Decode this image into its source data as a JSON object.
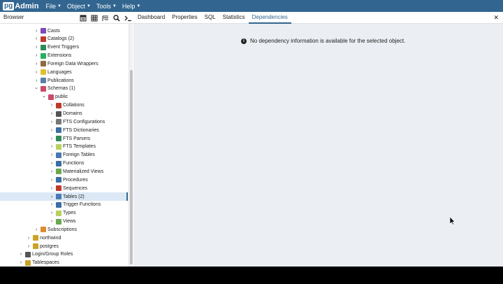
{
  "navbar": {
    "logo_pg": "pg",
    "logo_admin": "Admin",
    "menus": [
      "File",
      "Object",
      "Tools",
      "Help"
    ]
  },
  "browser": {
    "title": "Browser",
    "tools": [
      "object-properties-icon",
      "grid-icon",
      "filter-rows-icon",
      "search-icon",
      "query-tool-icon"
    ]
  },
  "tabs": [
    "Dashboard",
    "Properties",
    "SQL",
    "Statistics",
    "Dependencies"
  ],
  "active_tab": "Dependencies",
  "tree": [
    {
      "label": "Casts",
      "level": 4,
      "expanded": false,
      "icon": "cast-icon",
      "color": "#7c4bb8"
    },
    {
      "label": "Catalogs (2)",
      "level": 4,
      "expanded": false,
      "icon": "catalog-icon",
      "color": "#c0392b"
    },
    {
      "label": "Event Triggers",
      "level": 4,
      "expanded": false,
      "icon": "event-trigger-icon",
      "color": "#2e8b57"
    },
    {
      "label": "Extensions",
      "level": 4,
      "expanded": false,
      "icon": "extension-icon",
      "color": "#27ae60"
    },
    {
      "label": "Foreign Data Wrappers",
      "level": 4,
      "expanded": false,
      "icon": "fdw-icon",
      "color": "#8e6b3e"
    },
    {
      "label": "Languages",
      "level": 4,
      "expanded": false,
      "icon": "language-icon",
      "color": "#e0c030"
    },
    {
      "label": "Publications",
      "level": 4,
      "expanded": false,
      "icon": "publication-icon",
      "color": "#5a7fa8"
    },
    {
      "label": "Schemas (1)",
      "level": 4,
      "expanded": true,
      "icon": "schemas-icon",
      "color": "#c94a6b"
    },
    {
      "label": "public",
      "level": 5,
      "expanded": true,
      "icon": "schema-icon",
      "color": "#c94a6b"
    },
    {
      "label": "Collations",
      "level": 6,
      "expanded": false,
      "icon": "collation-icon",
      "color": "#c0392b"
    },
    {
      "label": "Domains",
      "level": 6,
      "expanded": false,
      "icon": "domain-icon",
      "color": "#555555"
    },
    {
      "label": "FTS Configurations",
      "level": 6,
      "expanded": false,
      "icon": "fts-config-icon",
      "color": "#777777"
    },
    {
      "label": "FTS Dictionaries",
      "level": 6,
      "expanded": false,
      "icon": "fts-dictionary-icon",
      "color": "#3a6ea5"
    },
    {
      "label": "FTS Parsers",
      "level": 6,
      "expanded": false,
      "icon": "fts-parser-icon",
      "color": "#2e8b57"
    },
    {
      "label": "FTS Templates",
      "level": 6,
      "expanded": false,
      "icon": "fts-template-icon",
      "color": "#b8d060"
    },
    {
      "label": "Foreign Tables",
      "level": 6,
      "expanded": false,
      "icon": "foreign-table-icon",
      "color": "#4a78b5"
    },
    {
      "label": "Functions",
      "level": 6,
      "expanded": false,
      "icon": "function-icon",
      "color": "#3a6ea5"
    },
    {
      "label": "Materialized Views",
      "level": 6,
      "expanded": false,
      "icon": "materialized-view-icon",
      "color": "#6aa84f"
    },
    {
      "label": "Procedures",
      "level": 6,
      "expanded": false,
      "icon": "procedure-icon",
      "color": "#3a6ea5"
    },
    {
      "label": "Sequences",
      "level": 6,
      "expanded": false,
      "icon": "sequence-icon",
      "color": "#c0392b"
    },
    {
      "label": "Tables (2)",
      "level": 6,
      "expanded": false,
      "icon": "table-icon",
      "color": "#4a78b5",
      "selected": true
    },
    {
      "label": "Trigger Functions",
      "level": 6,
      "expanded": false,
      "icon": "trigger-function-icon",
      "color": "#3a6ea5"
    },
    {
      "label": "Types",
      "level": 6,
      "expanded": false,
      "icon": "type-icon",
      "color": "#b8d060"
    },
    {
      "label": "Views",
      "level": 6,
      "expanded": false,
      "icon": "view-icon",
      "color": "#6aa84f"
    },
    {
      "label": "Subscriptions",
      "level": 4,
      "expanded": false,
      "icon": "subscription-icon",
      "color": "#e08a30"
    },
    {
      "label": "northwind",
      "level": 3,
      "expanded": false,
      "icon": "database-icon",
      "color": "#c9a227"
    },
    {
      "label": "postgres",
      "level": 3,
      "expanded": false,
      "icon": "database-icon",
      "color": "#c9a227"
    },
    {
      "label": "Login/Group Roles",
      "level": 2,
      "expanded": false,
      "icon": "roles-icon",
      "color": "#555555"
    },
    {
      "label": "Tablespaces",
      "level": 2,
      "expanded": false,
      "icon": "tablespace-icon",
      "color": "#c9a227"
    }
  ],
  "message": "No dependency information is available for the selected object."
}
